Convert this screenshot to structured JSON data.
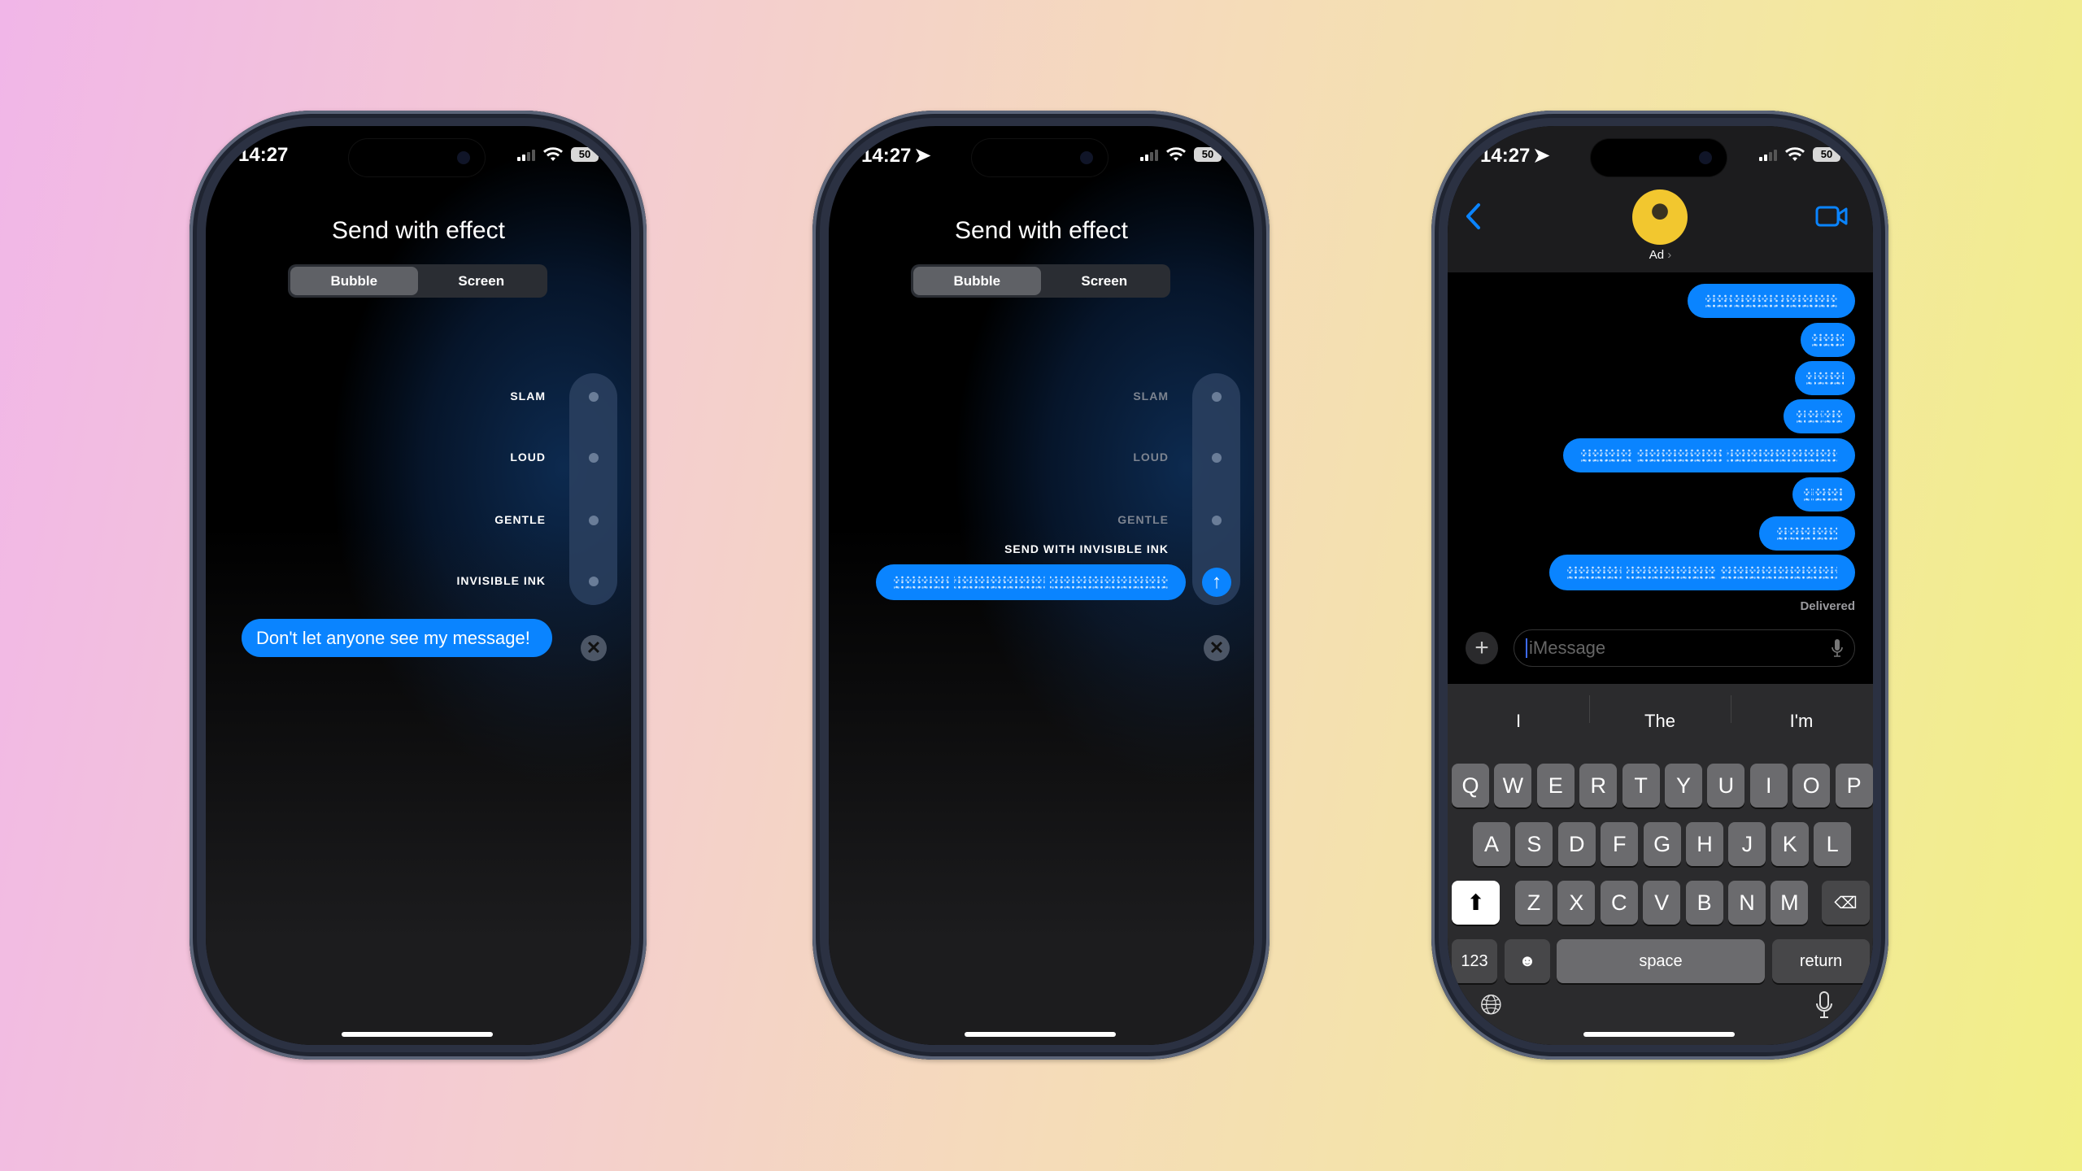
{
  "status": {
    "time": "14:27",
    "battery": "50"
  },
  "effect_screen": {
    "title": "Send with effect",
    "tabs": [
      "Bubble",
      "Screen"
    ],
    "effects": [
      "SLAM",
      "LOUD",
      "GENTLE",
      "INVISIBLE INK"
    ],
    "message": "Don't let anyone see my message!",
    "selected_effect_label": "SEND WITH INVISIBLE INK"
  },
  "conversation": {
    "contact_name": "Ad",
    "delivered": "Delivered",
    "input_placeholder": "iMessage",
    "suggestions": [
      "I",
      "The",
      "I'm"
    ],
    "keyboard": {
      "rows": [
        [
          "Q",
          "W",
          "E",
          "R",
          "T",
          "Y",
          "U",
          "I",
          "O",
          "P"
        ],
        [
          "A",
          "S",
          "D",
          "F",
          "G",
          "H",
          "J",
          "K",
          "L"
        ],
        [
          "Z",
          "X",
          "C",
          "V",
          "B",
          "N",
          "M"
        ]
      ],
      "numbers": "123",
      "space": "space",
      "return": "return"
    }
  },
  "colors": {
    "accent": "#0a84ff",
    "background_left": "#f1b6e8",
    "background_right": "#f2ef86"
  }
}
